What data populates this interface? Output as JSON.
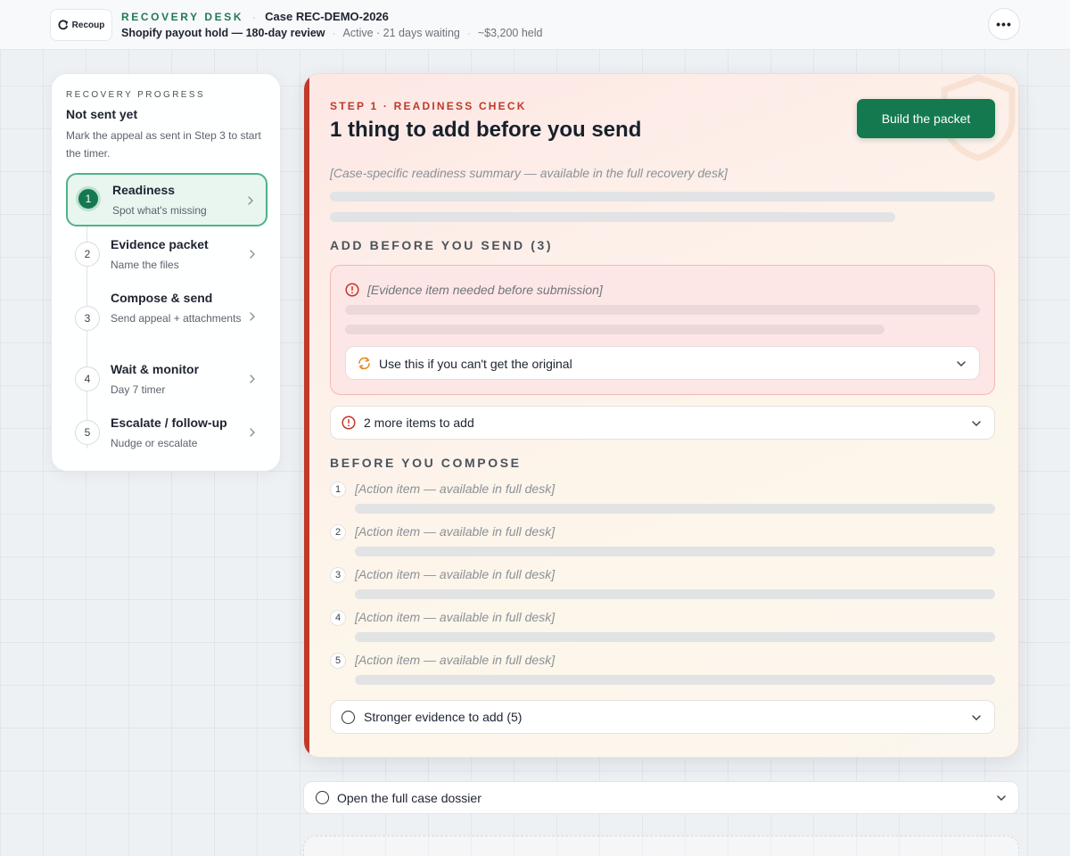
{
  "header": {
    "logo_text": "Recoup",
    "brand": "RECOVERY DESK",
    "case_id": "Case REC-DEMO-2026",
    "case_title": "Shopify payout hold — 180-day review",
    "status": "Active · 21 days waiting",
    "held_amount": "~$3,200 held",
    "more_label": "•••"
  },
  "progress": {
    "eyebrow": "RECOVERY PROGRESS",
    "status": "Not sent yet",
    "hint": "Mark the appeal as sent in Step 3 to start the timer.",
    "steps": [
      {
        "num": "1",
        "title": "Readiness",
        "subtitle": "Spot what's missing",
        "active": true
      },
      {
        "num": "2",
        "title": "Evidence packet",
        "subtitle": "Name the files",
        "active": false
      },
      {
        "num": "3",
        "title": "Compose & send",
        "subtitle": "Send appeal + attachments",
        "active": false
      },
      {
        "num": "4",
        "title": "Wait & monitor",
        "subtitle": "Day 7 timer",
        "active": false
      },
      {
        "num": "5",
        "title": "Escalate / follow-up",
        "subtitle": "Nudge or escalate",
        "active": false
      }
    ]
  },
  "main": {
    "eyebrow": "STEP 1 · READINESS CHECK",
    "headline": "1 thing to add before you send",
    "primary_button": "Build the packet",
    "summary_placeholder": "[Case-specific readiness summary — available in the full recovery desk]",
    "add_section_title": "ADD BEFORE YOU SEND (3)",
    "evidence_item": "[Evidence item needed before submission]",
    "fallback_label": "Use this if you can't get the original",
    "more_items_label": "2 more items to add",
    "compose_section_title": "BEFORE YOU COMPOSE",
    "action_items": [
      {
        "num": "1",
        "text": "[Action item — available in full desk]"
      },
      {
        "num": "2",
        "text": "[Action item — available in full desk]"
      },
      {
        "num": "3",
        "text": "[Action item — available in full desk]"
      },
      {
        "num": "4",
        "text": "[Action item — available in full desk]"
      },
      {
        "num": "5",
        "text": "[Action item — available in full desk]"
      }
    ],
    "stronger_evidence_label": "Stronger evidence to add (5)"
  },
  "dossier": {
    "label": "Open the full case dossier"
  },
  "colors": {
    "brand_green": "#14794f",
    "alert_red": "#c0392b"
  }
}
